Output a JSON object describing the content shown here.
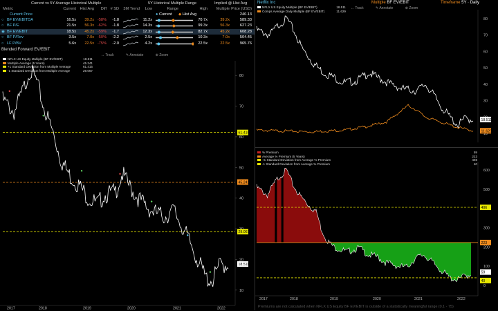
{
  "table": {
    "title": "Current vs 5Y Average Historical Multiple",
    "range_title": "5Y Historical Multiple Range",
    "implied_title": "Implied @ Hist Avg",
    "headers": [
      "Metric",
      "Current",
      "Hist Avg",
      "Diff",
      "# SD",
      "3M Trend",
      "Low",
      "Range",
      "High",
      "Multiple",
      "Price (USD)"
    ],
    "current_price_label": "Current Price",
    "current_price_value": "240.13",
    "legend_current": "Current",
    "legend_hist": "Hist Avg",
    "rows": [
      {
        "metric": "BF EV/EBITDA",
        "current": "16.5x",
        "hist": "39.2x",
        "diff": "-58%",
        "sd": "-1.8",
        "low": "11.2x",
        "high": "70.7x",
        "mult": "39.2x",
        "price": "589.33",
        "cur_pos": 0.09,
        "avg_pos": 0.47
      },
      {
        "metric": "BF P/E",
        "current": "21.5x",
        "hist": "56.3x",
        "diff": "-62%",
        "sd": "-1.8",
        "low": "14.3x",
        "high": "99.3x",
        "mult": "56.3x",
        "price": "627.23",
        "cur_pos": 0.08,
        "avg_pos": 0.49
      },
      {
        "metric": "BF EV/EBIT",
        "current": "18.5x",
        "hist": "45.2x",
        "diff": "-59%",
        "sd": "-1.7",
        "low": "12.3x",
        "high": "82.7x",
        "mult": "45.2x",
        "price": "608.28",
        "cur_pos": 0.09,
        "avg_pos": 0.46
      },
      {
        "metric": "BF P/Rev",
        "current": "3.5x",
        "hist": "7.0x",
        "diff": "-50%",
        "sd": "-2.2",
        "low": "2.5x",
        "high": "10.3x",
        "mult": "7.0x",
        "price": "504.45",
        "cur_pos": 0.13,
        "avg_pos": 0.58
      },
      {
        "metric": "LF P/BV",
        "current": "5.6x",
        "hist": "22.5x",
        "diff": "-75%",
        "sd": "-2.0",
        "low": "4.2x",
        "high": "22.5x",
        "mult": "22.5x",
        "price": "965.76",
        "cur_pos": 0.08,
        "avg_pos": 1.0
      }
    ]
  },
  "left_chart": {
    "title": "Blended Forward EV/EBIT",
    "toolbar": [
      "Track",
      "Annotate",
      "Zoom"
    ],
    "legend": [
      {
        "label": "NFLX US Equity Multiple (BF EV/EBIT)",
        "value": "18.511",
        "color": "#ffffff"
      },
      {
        "label": "Multiple Average (5 Years)",
        "value": "45.241",
        "color": "#f08c1e"
      },
      {
        "label": "+1 Standard Deviation from Multiple Average",
        "value": "61.415",
        "color": "#e6e600"
      },
      {
        "label": "-1 Standard Deviation from Multiple Average",
        "value": "29.067",
        "color": "#e6e600"
      }
    ],
    "y_ticks": [
      "80",
      "70",
      "60",
      "50",
      "40",
      "30",
      "20",
      "10"
    ],
    "x_years": [
      "2017",
      "2018",
      "2019",
      "2020",
      "2021",
      "2022"
    ],
    "tags": {
      "plus_sd": "61.415",
      "avg": "45.241",
      "minus_sd": "29.067",
      "current": "18.511"
    }
  },
  "right_top": {
    "company": "Netflix Inc",
    "multiple_label": "Multiple",
    "multiple_value": "BF EV/EBIT",
    "timeframe_label": "Timeframe",
    "timeframe_value": "5Y · Daily",
    "toolbar": [
      "Track",
      "Annotate",
      "Zoom"
    ],
    "legend": [
      {
        "label": "NFLX US Equity Multiple (BF EV/EBIT)",
        "value": "18.511",
        "color": "#ffffff"
      },
      {
        "label": "Comps Average Daily Multiple (BF EV/EBIT)",
        "value": "11.629",
        "color": "#f08c1e"
      }
    ],
    "y_ticks": [
      "80",
      "70",
      "60",
      "50",
      "40",
      "30",
      "20",
      "10"
    ],
    "tags": {
      "current": "18.511",
      "comps": "11.629"
    }
  },
  "right_bottom": {
    "legend": [
      {
        "label": "% Premium",
        "value": "59",
        "color": "#cc2222"
      },
      {
        "label": "Average % Premium (5 Years)",
        "value": "223",
        "color": "#f08c1e"
      },
      {
        "label": "+1 Standard Deviation from Average % Premium",
        "value": "406",
        "color": "#e6e600"
      },
      {
        "label": "-1 Standard Deviation from Average % Premium",
        "value": "40",
        "color": "#e6e600"
      }
    ],
    "y_ticks": [
      "600",
      "500",
      "400",
      "300",
      "200",
      "100",
      "0"
    ],
    "x_years": [
      "2017",
      "2018",
      "2019",
      "2020",
      "2021",
      "2022"
    ],
    "tags": {
      "plus_sd": "406",
      "avg": "223",
      "current": "59",
      "minus_sd": "40"
    },
    "footnote": "Premiums are not calculated when NFLX US Equity BF EV/EBIT is outside of a statistically meaningful range (0.1 - 75)"
  },
  "colors": {
    "orange": "#f08c1e",
    "yellow": "#e6e600",
    "cyan": "#5ec8f0",
    "red": "#a81010",
    "green": "#16a016"
  }
}
